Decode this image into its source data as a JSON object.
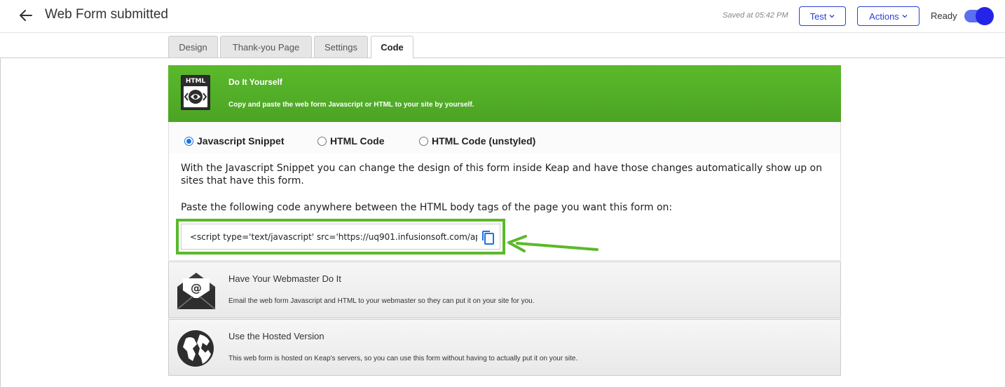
{
  "header": {
    "title": "Web Form submitted",
    "saved": "Saved at 05:42 PM",
    "test_label": "Test",
    "actions_label": "Actions",
    "ready_label": "Ready",
    "ready_toggle_on": true,
    "accent_color": "#2b3fd6"
  },
  "tabs": [
    {
      "label": "Design",
      "active": false
    },
    {
      "label": "Thank-you Page",
      "active": false
    },
    {
      "label": "Settings",
      "active": false
    },
    {
      "label": "Code",
      "active": true
    }
  ],
  "diy": {
    "icon_label": "HTML",
    "title": "Do It Yourself",
    "description": "Copy and paste the web form Javascript or HTML to your site by yourself.",
    "header_color": "#5bb92b",
    "radios": [
      {
        "label": "Javascript Snippet",
        "selected": true
      },
      {
        "label": "HTML Code",
        "selected": false
      },
      {
        "label": "HTML Code (unstyled)",
        "selected": false
      }
    ],
    "explanation": "With the Javascript Snippet you can change the design of this form inside Keap and have those changes automatically show up on sites that have this form.",
    "instruction": "Paste the following code anywhere between the HTML body tags of the page you want this form on:",
    "code": "<script type='text/javascript' src='https://uq901.infusionsoft.com/ap",
    "copy_icon": "copy-icon"
  },
  "webmaster": {
    "icon": "envelope-at-icon",
    "title": "Have Your Webmaster Do It",
    "description": "Email the web form Javascript and HTML to your webmaster so they can put it on your site for you."
  },
  "hosted": {
    "icon": "globe-icon",
    "title": "Use the Hosted Version",
    "description": "This web form is hosted on Keap's servers, so you can use this form without having to actually put it on your site."
  }
}
